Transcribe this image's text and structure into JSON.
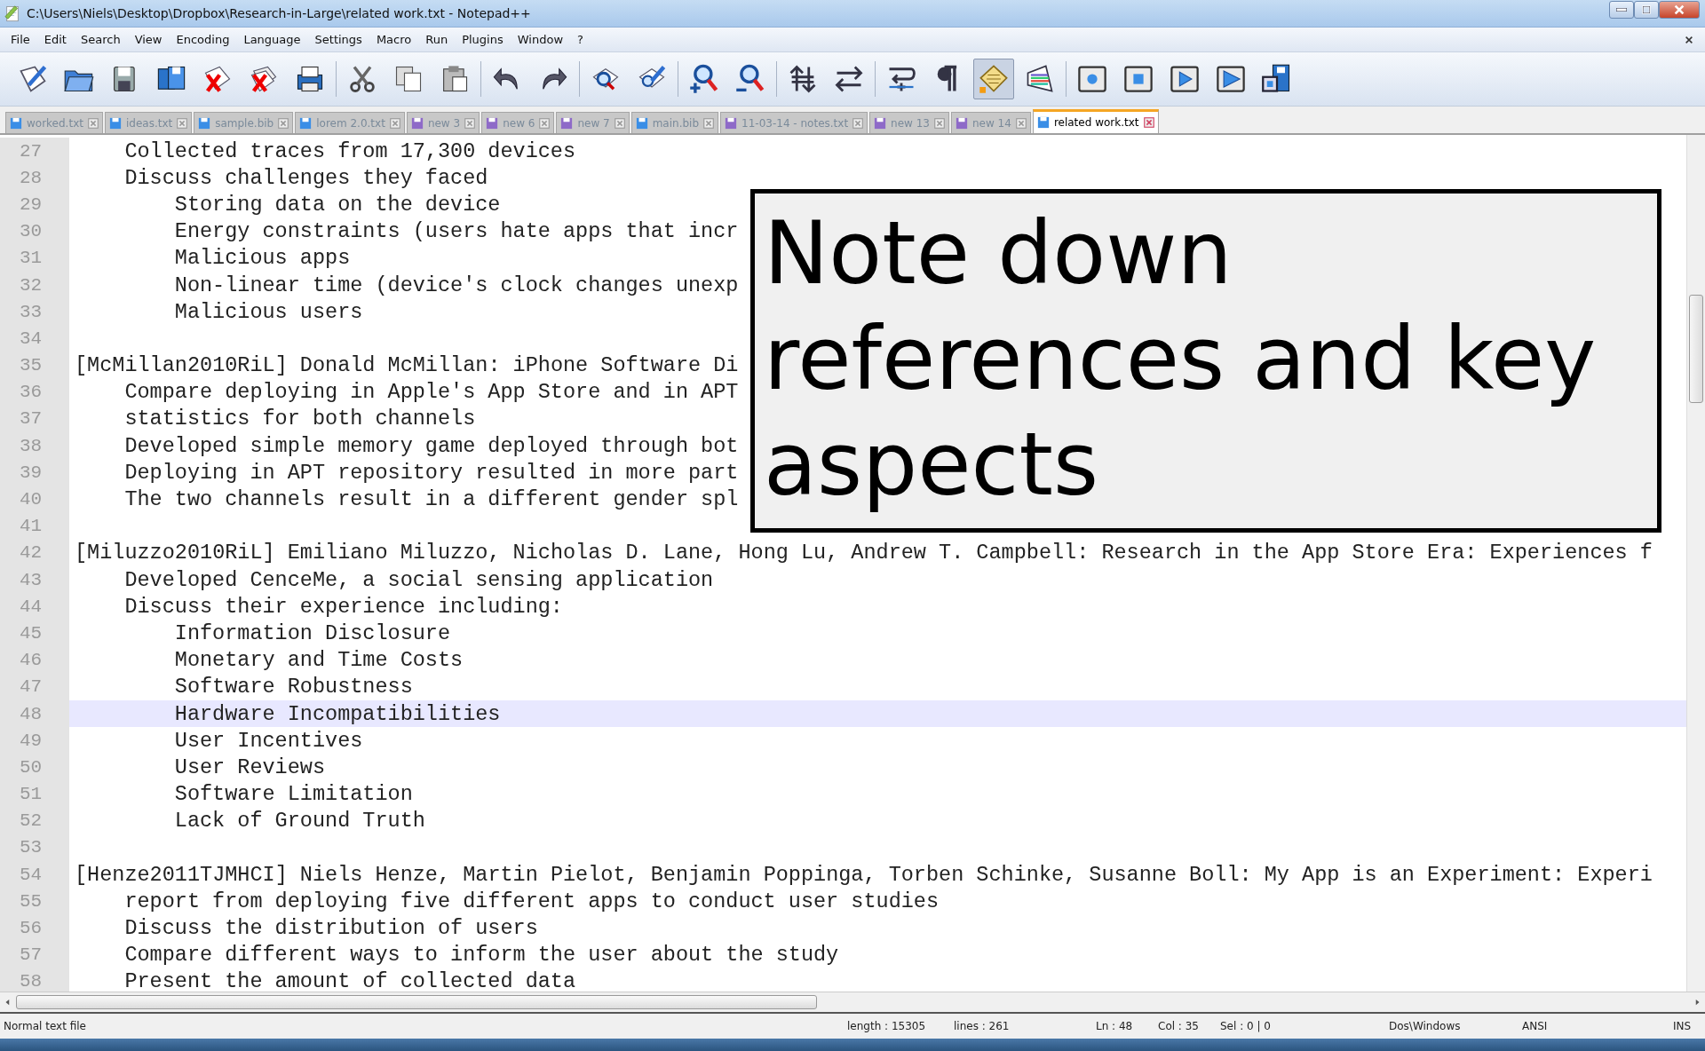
{
  "window": {
    "title": "C:\\Users\\Niels\\Desktop\\Dropbox\\Research-in-Large\\related work.txt - Notepad++"
  },
  "menu": [
    "File",
    "Edit",
    "Search",
    "View",
    "Encoding",
    "Language",
    "Settings",
    "Macro",
    "Run",
    "Plugins",
    "Window",
    "?"
  ],
  "toolbar": {
    "buttons": [
      {
        "pressed": false
      },
      {
        "pressed": false
      },
      {
        "pressed": false
      },
      {
        "pressed": false
      },
      {
        "pressed": false
      },
      {
        "pressed": false
      },
      {
        "pressed": false
      },
      {
        "pressed": false
      },
      {
        "pressed": false
      },
      {
        "pressed": false
      },
      {
        "pressed": false
      },
      {
        "pressed": false
      },
      {
        "pressed": false
      },
      {
        "pressed": false
      },
      {
        "pressed": false
      },
      {
        "pressed": false
      },
      {
        "pressed": false
      },
      {
        "pressed": false
      },
      {
        "pressed": false
      },
      {
        "pressed": false
      },
      {
        "pressed": true
      },
      {
        "pressed": false
      },
      {
        "pressed": false
      },
      {
        "pressed": false
      },
      {
        "pressed": false
      },
      {
        "pressed": false
      },
      {
        "pressed": false
      }
    ]
  },
  "tabs": [
    {
      "label": "worked.txt",
      "unsaved": false,
      "selected": false
    },
    {
      "label": "ideas.txt",
      "unsaved": false,
      "selected": false
    },
    {
      "label": "sample.bib",
      "unsaved": false,
      "selected": false
    },
    {
      "label": "lorem 2.0.txt",
      "unsaved": false,
      "selected": false
    },
    {
      "label": "new  3",
      "unsaved": true,
      "selected": false
    },
    {
      "label": "new  6",
      "unsaved": true,
      "selected": false
    },
    {
      "label": "new  7",
      "unsaved": true,
      "selected": false
    },
    {
      "label": "main.bib",
      "unsaved": false,
      "selected": false
    },
    {
      "label": "11-03-14 - notes.txt",
      "unsaved": true,
      "selected": false
    },
    {
      "label": "new  13",
      "unsaved": true,
      "selected": false
    },
    {
      "label": "new  14",
      "unsaved": true,
      "selected": false
    },
    {
      "label": "related work.txt",
      "unsaved": false,
      "selected": true
    }
  ],
  "editor": {
    "continued_lines": [
      {
        "number": "27",
        "text": "Collected traces from 17,300 devices",
        "current": false
      },
      {
        "number": "28",
        "text": "Discuss challenges they faced",
        "current": false,
        "children": [
          {
            "number": "29",
            "text": "Storing data on the device",
            "current": false
          },
          {
            "number": "30",
            "text": "Energy constraints (users hate apps that incr",
            "current": false
          },
          {
            "number": "31",
            "text": "Malicious apps",
            "current": false
          },
          {
            "number": "32",
            "text": "Non-linear time (device's clock changes unexp",
            "current": false
          },
          {
            "number": "33",
            "text": "Malicious users",
            "current": false
          }
        ]
      }
    ],
    "lines": [
      {
        "number": "34",
        "current": false
      },
      {
        "number": "35",
        "text": "[McMillan2010RiL] Donald McMillan: iPhone Software Di",
        "current": false,
        "children": [
          {
            "number": "36",
            "text": "Compare deploying in Apple's App Store and in APT",
            "current": false
          },
          {
            "number": "37",
            "text": "statistics for both channels",
            "current": false
          },
          {
            "number": "38",
            "text": "Developed simple memory game deployed through bot",
            "current": false
          },
          {
            "number": "39",
            "text": "Deploying in APT repository resulted in more part",
            "current": false
          },
          {
            "number": "40",
            "text": "The two channels result in a different gender spl",
            "current": false
          }
        ]
      },
      {
        "number": "41",
        "current": false
      },
      {
        "number": "42",
        "text": "[Miluzzo2010RiL] Emiliano Miluzzo, Nicholas D. Lane, Hong Lu, Andrew T. Campbell: Research in the App Store Era: Experiences f",
        "current": false,
        "children": [
          {
            "number": "43",
            "text": "Developed CenceMe, a social sensing application",
            "current": false
          },
          {
            "number": "44",
            "text": "Discuss their experience including:",
            "current": false,
            "children": [
              {
                "number": "45",
                "text": "Information Disclosure",
                "current": false
              },
              {
                "number": "46",
                "text": "Monetary and Time Costs",
                "current": false
              },
              {
                "number": "47",
                "text": "Software Robustness",
                "current": false
              },
              {
                "number": "48",
                "text": "Hardware Incompatibilities",
                "current": true
              },
              {
                "number": "49",
                "text": "User Incentives",
                "current": false
              },
              {
                "number": "50",
                "text": "User Reviews",
                "current": false
              },
              {
                "number": "51",
                "text": "Software Limitation",
                "current": false
              },
              {
                "number": "52",
                "text": "Lack of Ground Truth",
                "current": false
              }
            ]
          }
        ]
      },
      {
        "number": "53",
        "current": false
      },
      {
        "number": "54",
        "text": "[Henze2011TJMHCI] Niels Henze, Martin Pielot, Benjamin Poppinga, Torben Schinke, Susanne Boll: My App is an Experiment: Experi",
        "current": false,
        "children": [
          {
            "number": "55",
            "text": "report from deploying five different apps to conduct user studies",
            "current": false
          },
          {
            "number": "56",
            "text": "Discuss the distribution of users",
            "current": false
          },
          {
            "number": "57",
            "text": "Compare different ways to inform the user about the study",
            "current": false
          },
          {
            "number": "58",
            "text": "Present the amount of collected data",
            "current": false
          }
        ]
      }
    ]
  },
  "callout": {
    "text": "Note down references and key aspects"
  },
  "status_bar": {
    "file_type": "Normal text file",
    "length": "length : 15305",
    "lines": "lines : 261",
    "ln": "Ln : 48",
    "col": "Col : 35",
    "sel": "Sel : 0 | 0",
    "eol": "Dos\\Windows",
    "encoding": "ANSI",
    "mode": "INS"
  }
}
